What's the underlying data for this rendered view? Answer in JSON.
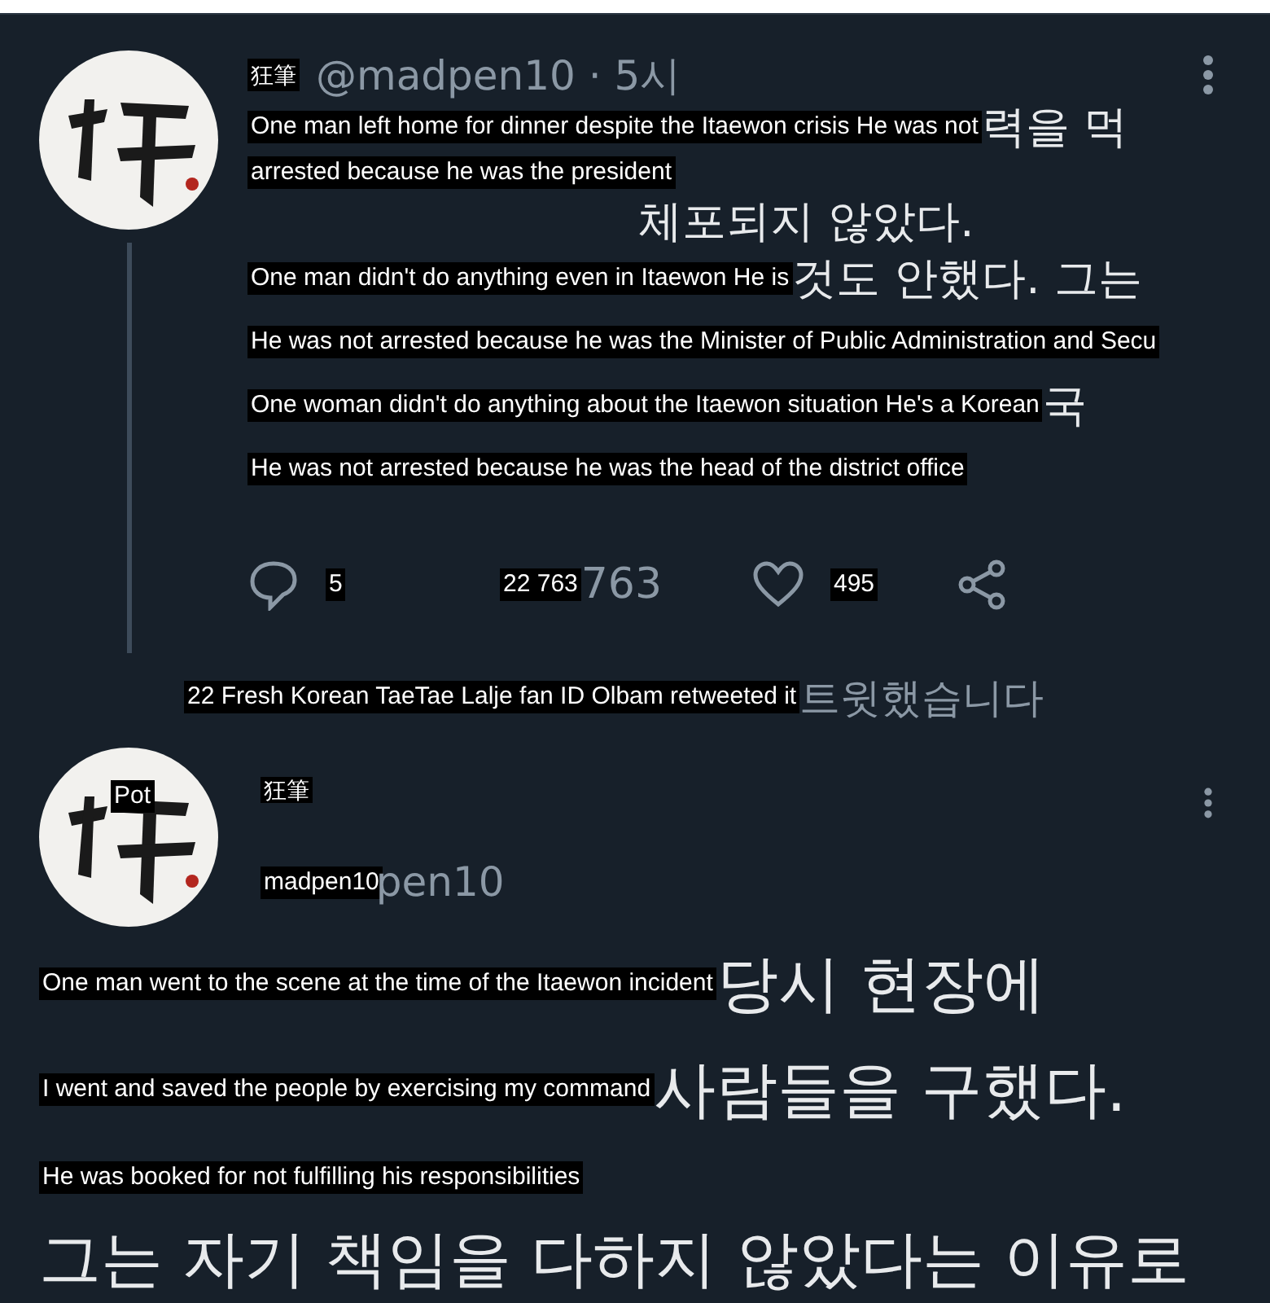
{
  "tweets": [
    {
      "name_overlay": "狂筆",
      "handle": {
        "text": "@madpen10 · 5시"
      },
      "lines": [
        {
          "overlay": "One man left home for dinner despite the Itaewon crisis He was not",
          "text": "력을 먹"
        },
        {
          "overlay": "arrested because he was the president"
        },
        {
          "text": "체포되지 않았다."
        },
        {
          "overlay": "One man didn't do anything even in Itaewon He is",
          "text": "것도 안했다. 그는"
        },
        {
          "overlay": "He was not arrested because he was the Minister of Public Administration and Secu"
        },
        {
          "overlay": "One woman didn't do anything about the Itaewon situation He's a Korean",
          "text": "국"
        },
        {
          "overlay": "He was not arrested because he was the head of the district office"
        }
      ],
      "stats": {
        "reply": {
          "overlay": "5"
        },
        "retweet": {
          "overlay": "22 763",
          "text": "763"
        },
        "like": {
          "overlay": "495"
        }
      },
      "retweeted_by": {
        "overlay": "22 Fresh Korean TaeTae Lalje fan ID Olbam retweeted it",
        "text": "트윗했습니다"
      }
    },
    {
      "avatar": {
        "kind": "picture",
        "overlay": "Pot"
      },
      "name_overlay": "狂筆",
      "handle": {
        "overlay": "madpen10",
        "text": "pen10"
      },
      "lines": [
        {
          "overlay": "One man went to the scene at the time of the Itaewon incident",
          "text": "당시 현장에"
        },
        {
          "overlay": "I went and saved the people by exercising my command",
          "text": "사람들을 구했다."
        },
        {
          "overlay": "He was booked for not fulfilling his responsibilities"
        },
        {
          "text": "그는 자기 책임을 다하지 않았다는 이유로"
        }
      ]
    }
  ]
}
